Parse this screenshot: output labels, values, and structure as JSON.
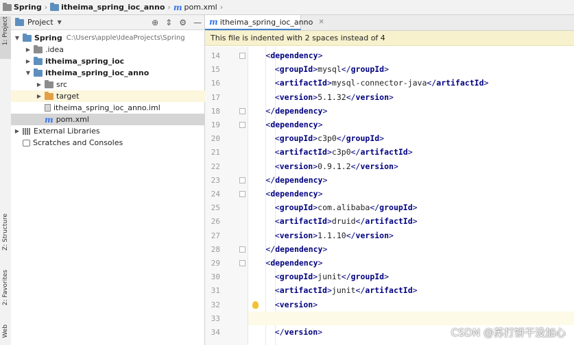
{
  "breadcrumb": [
    {
      "label": "Spring",
      "icon": "folder-icon"
    },
    {
      "label": "itheima_spring_ioc_anno",
      "icon": "folder-icon"
    },
    {
      "label": "pom.xml",
      "icon": "maven-file-icon"
    }
  ],
  "toolwindows": {
    "project_tab": "1: Project",
    "structure_tab": "Z: Structure",
    "favorites_tab": "2: Favorites",
    "web_tab": "Web"
  },
  "project_panel": {
    "title": "Project",
    "tree": [
      {
        "label": "Spring",
        "path": "C:\\Users\\apple\\IdeaProjects\\Spring",
        "depth": 0,
        "expanded": true,
        "icon": "folder-icon",
        "bold": true
      },
      {
        "label": ".idea",
        "depth": 1,
        "expanded": false,
        "icon": "folder-icon"
      },
      {
        "label": "itheima_spring_ioc",
        "depth": 1,
        "expanded": false,
        "icon": "module-folder-icon",
        "bold": true
      },
      {
        "label": "itheima_spring_ioc_anno",
        "depth": 1,
        "expanded": true,
        "icon": "module-folder-icon",
        "bold": true
      },
      {
        "label": "src",
        "depth": 2,
        "expanded": false,
        "icon": "folder-icon"
      },
      {
        "label": "target",
        "depth": 2,
        "expanded": false,
        "icon": "excluded-folder-icon"
      },
      {
        "label": "itheima_spring_ioc_anno.iml",
        "depth": 2,
        "icon": "iml-file-icon"
      },
      {
        "label": "pom.xml",
        "depth": 2,
        "icon": "maven-file-icon",
        "selected": true
      },
      {
        "label": "External Libraries",
        "depth": 0,
        "expanded": false,
        "icon": "library-icon"
      },
      {
        "label": "Scratches and Consoles",
        "depth": 0,
        "icon": "scratch-icon"
      }
    ]
  },
  "editor": {
    "tab_label": "itheima_spring_ioc_anno",
    "notice": "This file is indented with 2 spaces instead of 4",
    "lines": [
      {
        "num": "14",
        "indent": 1,
        "parts": [
          [
            "br",
            "<"
          ],
          [
            "tag",
            "dependency"
          ],
          [
            "br",
            ">"
          ]
        ]
      },
      {
        "num": "15",
        "indent": 2,
        "parts": [
          [
            "br",
            "<"
          ],
          [
            "tag",
            "groupId"
          ],
          [
            "br",
            ">"
          ],
          [
            "txt",
            "mysql"
          ],
          [
            "br",
            "</"
          ],
          [
            "tag",
            "groupId"
          ],
          [
            "br",
            ">"
          ]
        ]
      },
      {
        "num": "16",
        "indent": 2,
        "parts": [
          [
            "br",
            "<"
          ],
          [
            "tag",
            "artifactId"
          ],
          [
            "br",
            ">"
          ],
          [
            "txt",
            "mysql-connector-java"
          ],
          [
            "br",
            "</"
          ],
          [
            "tag",
            "artifactId"
          ],
          [
            "br",
            ">"
          ]
        ]
      },
      {
        "num": "17",
        "indent": 2,
        "parts": [
          [
            "br",
            "<"
          ],
          [
            "tag",
            "version"
          ],
          [
            "br",
            ">"
          ],
          [
            "txt",
            "5.1.32"
          ],
          [
            "br",
            "</"
          ],
          [
            "tag",
            "version"
          ],
          [
            "br",
            ">"
          ]
        ]
      },
      {
        "num": "18",
        "indent": 1,
        "parts": [
          [
            "br",
            "</"
          ],
          [
            "tag",
            "dependency"
          ],
          [
            "br",
            ">"
          ]
        ]
      },
      {
        "num": "19",
        "indent": 1,
        "parts": [
          [
            "br",
            "<"
          ],
          [
            "tag",
            "dependency"
          ],
          [
            "br",
            ">"
          ]
        ]
      },
      {
        "num": "20",
        "indent": 2,
        "parts": [
          [
            "br",
            "<"
          ],
          [
            "tag",
            "groupId"
          ],
          [
            "br",
            ">"
          ],
          [
            "txt",
            "c3p0"
          ],
          [
            "br",
            "</"
          ],
          [
            "tag",
            "groupId"
          ],
          [
            "br",
            ">"
          ]
        ]
      },
      {
        "num": "21",
        "indent": 2,
        "parts": [
          [
            "br",
            "<"
          ],
          [
            "tag",
            "artifactId"
          ],
          [
            "br",
            ">"
          ],
          [
            "txt",
            "c3p0"
          ],
          [
            "br",
            "</"
          ],
          [
            "tag",
            "artifactId"
          ],
          [
            "br",
            ">"
          ]
        ]
      },
      {
        "num": "22",
        "indent": 2,
        "parts": [
          [
            "br",
            "<"
          ],
          [
            "tag",
            "version"
          ],
          [
            "br",
            ">"
          ],
          [
            "txt",
            "0.9.1.2"
          ],
          [
            "br",
            "</"
          ],
          [
            "tag",
            "version"
          ],
          [
            "br",
            ">"
          ]
        ]
      },
      {
        "num": "23",
        "indent": 1,
        "parts": [
          [
            "br",
            "</"
          ],
          [
            "tag",
            "dependency"
          ],
          [
            "br",
            ">"
          ]
        ]
      },
      {
        "num": "24",
        "indent": 1,
        "parts": [
          [
            "br",
            "<"
          ],
          [
            "tag",
            "dependency"
          ],
          [
            "br",
            ">"
          ]
        ]
      },
      {
        "num": "25",
        "indent": 2,
        "parts": [
          [
            "br",
            "<"
          ],
          [
            "tag",
            "groupId"
          ],
          [
            "br",
            ">"
          ],
          [
            "txt",
            "com.alibaba"
          ],
          [
            "br",
            "</"
          ],
          [
            "tag",
            "groupId"
          ],
          [
            "br",
            ">"
          ]
        ]
      },
      {
        "num": "26",
        "indent": 2,
        "parts": [
          [
            "br",
            "<"
          ],
          [
            "tag",
            "artifactId"
          ],
          [
            "br",
            ">"
          ],
          [
            "txt",
            "druid"
          ],
          [
            "br",
            "</"
          ],
          [
            "tag",
            "artifactId"
          ],
          [
            "br",
            ">"
          ]
        ]
      },
      {
        "num": "27",
        "indent": 2,
        "parts": [
          [
            "br",
            "<"
          ],
          [
            "tag",
            "version"
          ],
          [
            "br",
            ">"
          ],
          [
            "txt",
            "1.1.10"
          ],
          [
            "br",
            "</"
          ],
          [
            "tag",
            "version"
          ],
          [
            "br",
            ">"
          ]
        ]
      },
      {
        "num": "28",
        "indent": 1,
        "parts": [
          [
            "br",
            "</"
          ],
          [
            "tag",
            "dependency"
          ],
          [
            "br",
            ">"
          ]
        ]
      },
      {
        "num": "29",
        "indent": 1,
        "parts": [
          [
            "br",
            "<"
          ],
          [
            "tag",
            "dependency"
          ],
          [
            "br",
            ">"
          ]
        ]
      },
      {
        "num": "30",
        "indent": 2,
        "parts": [
          [
            "br",
            "<"
          ],
          [
            "tag",
            "groupId"
          ],
          [
            "br",
            ">"
          ],
          [
            "txt",
            "junit"
          ],
          [
            "br",
            "</"
          ],
          [
            "tag",
            "groupId"
          ],
          [
            "br",
            ">"
          ]
        ]
      },
      {
        "num": "31",
        "indent": 2,
        "parts": [
          [
            "br",
            "<"
          ],
          [
            "tag",
            "artifactId"
          ],
          [
            "br",
            ">"
          ],
          [
            "txt",
            "junit"
          ],
          [
            "br",
            "</"
          ],
          [
            "tag",
            "artifactId"
          ],
          [
            "br",
            ">"
          ]
        ]
      },
      {
        "num": "32",
        "indent": 2,
        "parts": [
          [
            "br",
            "<"
          ],
          [
            "tag",
            "version"
          ],
          [
            "br",
            ">"
          ]
        ],
        "bulb": true
      },
      {
        "num": "33",
        "indent": 0,
        "parts": [],
        "current": true
      },
      {
        "num": "34",
        "indent": 2,
        "parts": [
          [
            "br",
            "</"
          ],
          [
            "tag",
            "version"
          ],
          [
            "br",
            ">"
          ]
        ]
      }
    ]
  },
  "watermark": "CSDN @苏打饼干没加心"
}
